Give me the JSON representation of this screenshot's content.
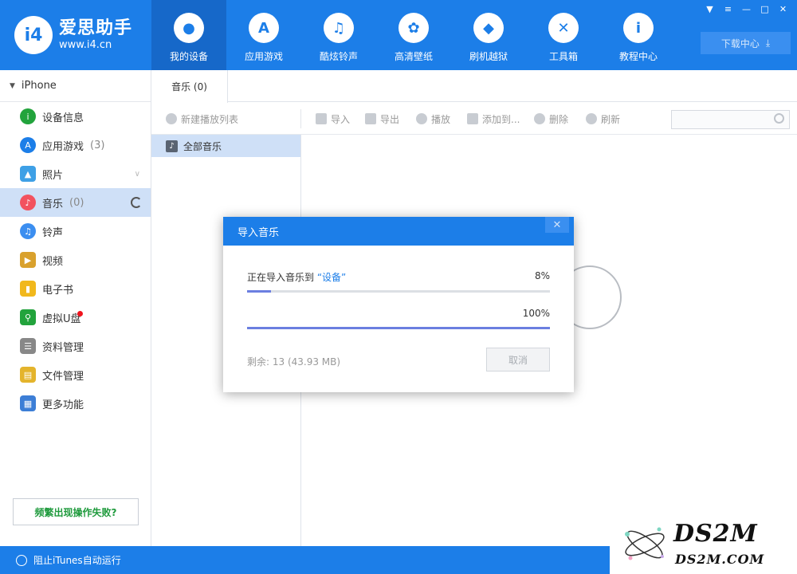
{
  "app": {
    "name": "爱思助手",
    "url": "www.i4.cn",
    "logo_mark": "i4"
  },
  "nav": [
    {
      "label": "我的设备",
      "icon": "apple-icon"
    },
    {
      "label": "应用游戏",
      "icon": "app-store-icon"
    },
    {
      "label": "酷炫铃声",
      "icon": "bell-icon"
    },
    {
      "label": "高清壁纸",
      "icon": "flower-icon"
    },
    {
      "label": "刷机越狱",
      "icon": "dropbox-icon"
    },
    {
      "label": "工具箱",
      "icon": "tools-icon"
    },
    {
      "label": "教程中心",
      "icon": "info-icon"
    }
  ],
  "header": {
    "download_label": "下载中心"
  },
  "sidebar": {
    "device": "iPhone",
    "items": [
      {
        "label": "设备信息",
        "count": "",
        "color": "#22a33c"
      },
      {
        "label": "应用游戏",
        "count": "(3)",
        "color": "#1c7ee8"
      },
      {
        "label": "照片",
        "count": "",
        "color": "#3ea0e6"
      },
      {
        "label": "音乐",
        "count": "(0)",
        "color": "#f2525f"
      },
      {
        "label": "铃声",
        "count": "",
        "color": "#3b8ef0"
      },
      {
        "label": "视频",
        "count": "",
        "color": "#d9a12d"
      },
      {
        "label": "电子书",
        "count": "",
        "color": "#f1b81c"
      },
      {
        "label": "虚拟U盘",
        "count": "",
        "color": "#22a33c"
      },
      {
        "label": "资料管理",
        "count": "",
        "color": "#888888"
      },
      {
        "label": "文件管理",
        "count": "",
        "color": "#e4b42c"
      },
      {
        "label": "更多功能",
        "count": "",
        "color": "#3c7ed6"
      }
    ],
    "fail_button": "频繁出现操作失败?",
    "itunes_toggle": "阻止iTunes自动运行"
  },
  "main": {
    "tab": "音乐 (0)",
    "toolbar": {
      "new_playlist": "新建播放列表",
      "import": "导入",
      "export": "导出",
      "play": "播放",
      "add_to": "添加到...",
      "delete": "删除",
      "refresh": "刷新"
    },
    "list": {
      "all_music": "全部音乐"
    }
  },
  "dialog": {
    "title": "导入音乐",
    "status_prefix": "正在导入音乐到",
    "status_target": "“设备”",
    "progress_current": 0.08,
    "progress_current_label": "8%",
    "progress_total": 1.0,
    "progress_total_label": "100%",
    "remaining": "剩余: 13 (43.93 MB)",
    "cancel": "取消"
  },
  "watermark": {
    "big": "DS2M",
    "small": "DS2M.COM"
  }
}
